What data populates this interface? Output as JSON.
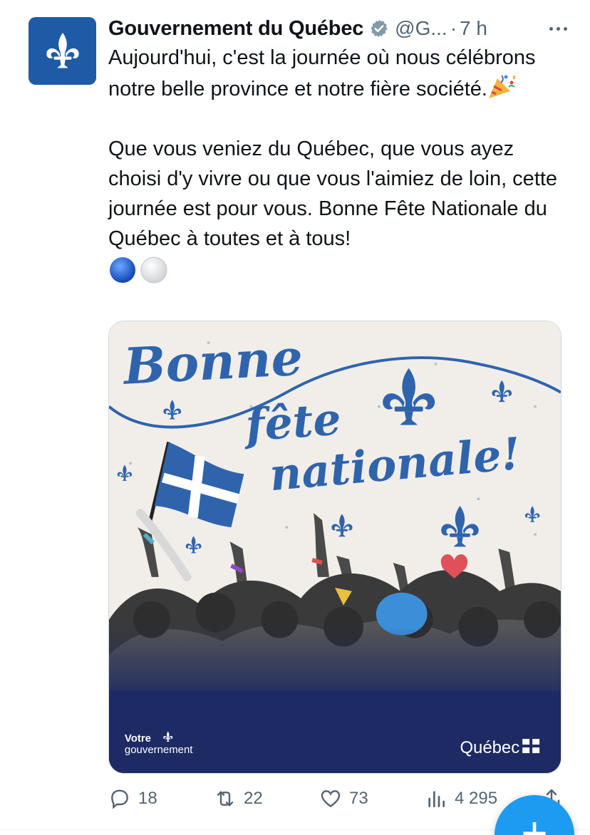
{
  "author": {
    "name": "Gouvernement du Québec",
    "handle": "@G...",
    "separator": "·",
    "time": "7 h",
    "avatar_icon": "fleur-de-lis-icon",
    "avatar_color": "#1f5aa6"
  },
  "tweet": {
    "paragraph_1": "Aujourd'hui, c'est la journée où nous célébrons notre belle province et notre fière société.",
    "paragraph_2": "Que vous veniez du Québec, que vous ayez choisi d'y vivre ou que vous l'aimiez de loin, cette journée est pour vous. Bonne Fête Nationale du Québec à toutes et à tous!",
    "emoji_1": "party-popper-icon",
    "emoji_2": "blue-circle-icon",
    "emoji_3": "white-circle-icon"
  },
  "media": {
    "headline_1": "Bonne",
    "headline_2": "fête",
    "headline_3": "nationale!",
    "footer_left_1": "Votre",
    "footer_left_2": "gouvernement",
    "footer_right": "Québec",
    "primary_color": "#2f64ad",
    "navy_color": "#1d2a63",
    "background_color": "#f1eee9"
  },
  "actions": {
    "replies": "18",
    "reposts": "22",
    "likes": "73",
    "views": "4 295"
  },
  "fab_label": "+"
}
